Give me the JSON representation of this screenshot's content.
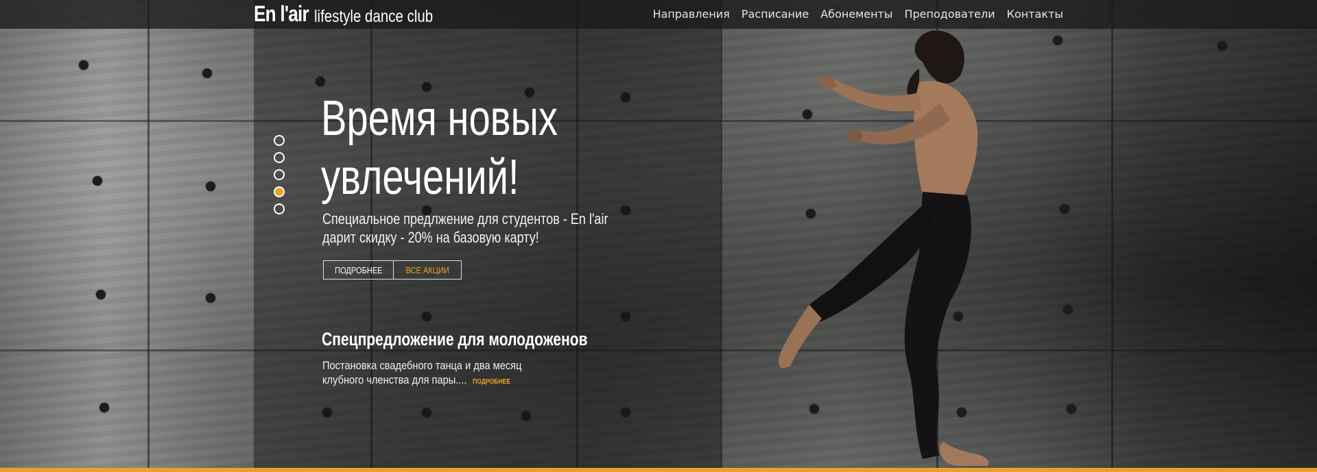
{
  "brand": {
    "name": "En l'air",
    "tagline": "lifestyle dance club"
  },
  "nav": {
    "items": [
      "Направления",
      "Расписание",
      "Абонементы",
      "Преподователи",
      "Контакты"
    ]
  },
  "slider": {
    "count": 5,
    "active_index": 3
  },
  "hero": {
    "title_line1": "Время новых",
    "title_line2": "увлечений!",
    "subtitle": "Специальное предлжение для студентов - En l'air дарит скидку - 20% на базовую карту!",
    "button_more": "ПОДРОБНЕЕ",
    "button_promos": "ВСЕ АКЦИИ"
  },
  "offer": {
    "title": "Спецпредложение для молодоженов",
    "text": "Постановка свадебного танца и два месяц клубного членства для пары....",
    "more": "ПОДРОБНЕЕ"
  },
  "colors": {
    "accent": "#f0a028",
    "topbar": "#19191b",
    "text": "#ffffff"
  }
}
